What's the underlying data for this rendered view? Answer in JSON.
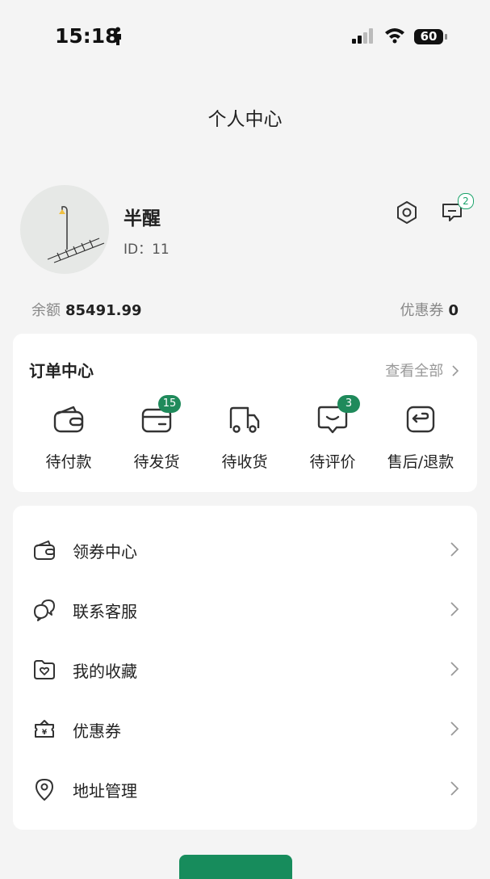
{
  "status_bar": {
    "time": "15:18",
    "battery": "60"
  },
  "header": {
    "title": "个人中心"
  },
  "profile": {
    "name": "半醒",
    "id_text": "ID：11",
    "message_count": "2"
  },
  "stats": {
    "balance_label": "余额",
    "balance_value": "85491.99",
    "coupon_label": "优惠券",
    "coupon_value": "0"
  },
  "orders": {
    "title": "订单中心",
    "view_all": "查看全部",
    "items": [
      {
        "label": "待付款",
        "icon": "wallet-icon",
        "badge": ""
      },
      {
        "label": "待发货",
        "icon": "box-icon",
        "badge": "15"
      },
      {
        "label": "待收货",
        "icon": "truck-icon",
        "badge": ""
      },
      {
        "label": "待评价",
        "icon": "review-icon",
        "badge": "3"
      },
      {
        "label": "售后/退款",
        "icon": "refund-icon",
        "badge": ""
      }
    ]
  },
  "menu": {
    "items": [
      {
        "label": "领券中心",
        "icon": "coupon-center-icon"
      },
      {
        "label": "联系客服",
        "icon": "chat-bubbles-icon"
      },
      {
        "label": "我的收藏",
        "icon": "favorites-folder-icon"
      },
      {
        "label": "优惠券",
        "icon": "yen-voucher-icon"
      },
      {
        "label": "地址管理",
        "icon": "location-pin-icon"
      }
    ]
  },
  "colors": {
    "accent": "#1f8a5b",
    "background": "#f4f4f4",
    "card": "#ffffff"
  }
}
